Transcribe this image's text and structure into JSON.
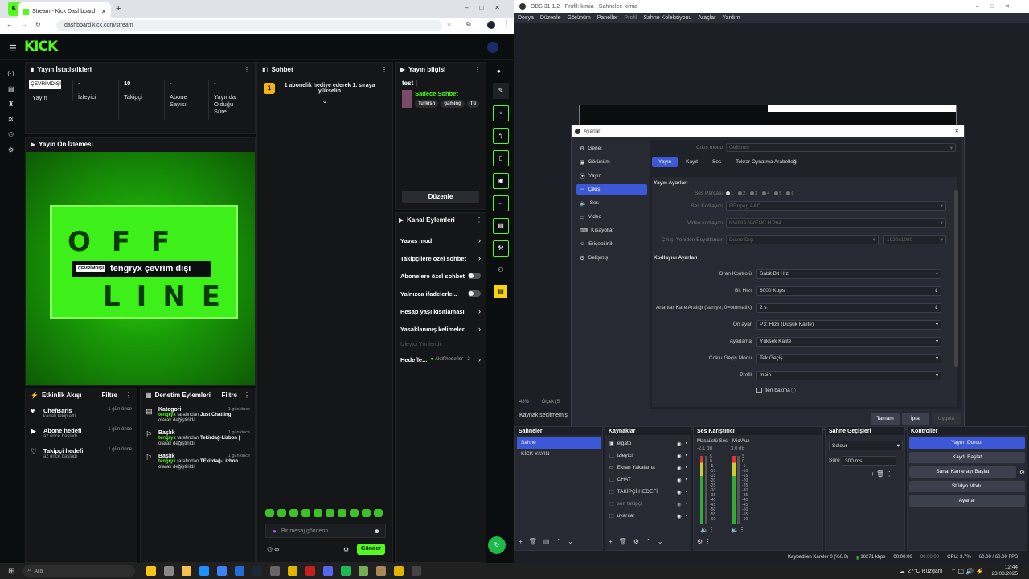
{
  "browser": {
    "tab_title": "Stream - Kick Dashboard",
    "url": "dashboard.kick.com/stream",
    "kick_badge": "K 0"
  },
  "kick": {
    "logo": "KICK",
    "stats": {
      "title": "Yayın İstatistikleri",
      "status_value": "ÇEVRİMDIŞI",
      "status_label": "Yayın",
      "viewers_value": "-",
      "viewers_label": "İzleyici",
      "followers_value": "10",
      "followers_label": "Takipçi",
      "subs_value": "-",
      "subs_label": "Abone Sayısı",
      "duration_value": "-",
      "duration_label": "Yayında Olduğu Süre"
    },
    "preview": {
      "title": "Yayın Ön İzlemesi",
      "badge": "ÇEVRİMDIŞI",
      "text": "tengryx çevrim dışı",
      "offline_row1": "OFF",
      "offline_row2": "LINE"
    },
    "chat": {
      "title": "Sohbet",
      "goal_badge": "1",
      "goal_text": "1 abonelik hediye ederek 1. sıraya yükselin",
      "input_placeholder": "Bir mesaj gönderin",
      "send_label": "Gönder"
    },
    "stream_info": {
      "title": "Yayın bilgisi",
      "stream_title": "test |",
      "category": "Sadece Sohbet",
      "tags": [
        "Turkish",
        "gaming",
        "Tü"
      ],
      "edit_label": "Düzenle"
    },
    "channel_actions": {
      "title": "Kanal Eylemleri",
      "items": [
        {
          "label": "Yavaş mod",
          "ctl": "chev"
        },
        {
          "label": "Takipçilere özel sohbet",
          "ctl": "chev"
        },
        {
          "label": "Abonelere özel sohbet",
          "ctl": "toggle"
        },
        {
          "label": "Yalnızca ifadelerle...",
          "ctl": "toggle"
        },
        {
          "label": "Hesap yaşı kısıtlaması",
          "ctl": "chev"
        },
        {
          "label": "Yasaklanmış kelimeler",
          "ctl": "chev"
        }
      ],
      "moderators": "İzleyici Yönlendir",
      "goals_label": "Hedefle...",
      "goals_value": "Aktif hedefler - 2"
    },
    "activity": {
      "title": "Etkinlik Akışı",
      "filter": "Filtre",
      "items": [
        {
          "name": "ChefBaris",
          "desc": "kanalı takip etti",
          "time": "1 gün önce"
        },
        {
          "name": "Abone hedefi",
          "desc": "az önce başladı",
          "time": "1 gün önce"
        },
        {
          "name": "Takipçi hedefi",
          "desc": "az önce başladı",
          "time": "1 gün önce"
        }
      ]
    },
    "mod": {
      "title": "Denetim Eylemleri",
      "filter": "Filtre",
      "items": [
        {
          "title": "Kategori",
          "time": "1 gün önce",
          "user": "tengryx",
          "mid": " tarafından ",
          "value": "Just Chatting",
          "tail": "olarak değiştirildi"
        },
        {
          "title": "Başlık",
          "time": "1 gün önce",
          "user": "tengryx",
          "mid": " tarafından ",
          "value": "Tekirdağ-Lizbon |",
          "tail": "olarak değiştirildi"
        },
        {
          "title": "Başlık",
          "time": "1 gün önce",
          "user": "tengryx",
          "mid": " tarafından ",
          "value": "TEkirdağ-Lizbon |",
          "tail": "olarak değiştirildi"
        }
      ]
    }
  },
  "obs": {
    "title": "OBS 31.1.2 - Profil: kimia - Sahneler: kimia",
    "menu": [
      "Dosya",
      "Düzenle",
      "Görünüm",
      "Paneller",
      "Profil",
      "Sahne Koleksiyonu",
      "Araçlar",
      "Yardım"
    ],
    "settings": {
      "title": "Ayarlar",
      "nav": [
        "Genel",
        "Görünüm",
        "Yayın",
        "Çıkış",
        "Ses",
        "Video",
        "Kısayollar",
        "Erişebilirlik",
        "Gelişmiş"
      ],
      "output_mode_label": "Çıkış modu",
      "output_mode": "Gelişmiş",
      "tabs": [
        "Yayın",
        "Kayıt",
        "Ses",
        "Tekrar Oynatma Arabelleği"
      ],
      "section1": "Yayın Ayarları",
      "audio_track_label": "Ses Parçası",
      "tracks": [
        "1",
        "2",
        "3",
        "4",
        "5",
        "6"
      ],
      "audio_encoder_label": "Ses Kodlayıcı",
      "audio_encoder": "FFmpeg AAC",
      "video_encoder_label": "Video kodlayıcı",
      "video_encoder": "NVIDIA NVENC H.264",
      "rescale_label": "Çıkışı Yeniden Boyutlandır",
      "rescale": "Devre Dışı",
      "rescale_res": "1920x1080",
      "section2": "Kodlayıcı Ayarları",
      "rows": [
        {
          "label": "Oran Kontrolü",
          "value": "Sabit Bit Hızı",
          "type": "select"
        },
        {
          "label": "Bit Hızı",
          "value": "8000 Kbps",
          "type": "spin"
        },
        {
          "label": "Anahtar Kare Aralığı (saniye, 0=otomatik)",
          "value": "2 s",
          "type": "spin"
        },
        {
          "label": "Ön ayar",
          "value": "P3: Hızlı (Düşük Kalite)",
          "type": "select"
        },
        {
          "label": "Ayarlama",
          "value": "Yüksek Kalite",
          "type": "select"
        },
        {
          "label": "Çoklu Geçiş Modu",
          "value": "Tek Geçiş",
          "type": "select"
        },
        {
          "label": "Profil",
          "value": "main",
          "type": "select"
        }
      ],
      "lookahead": "İleri bakma",
      "ok": "Tamam",
      "cancel": "İptal",
      "apply": "Uygula"
    },
    "no_source": "Kaynak seçilmemiş",
    "zoom": "48%",
    "zoom_label": "Ölçek (5",
    "docks": {
      "scenes": {
        "title": "Sahneler",
        "items": [
          "Sahne",
          "KİCK YAYIN"
        ]
      },
      "sources": {
        "title": "Kaynaklar",
        "items": [
          "elgato",
          "izleyici",
          "Ekran Yakalama",
          "CHAT",
          "TAKİPÇİ HEDEFİ",
          "son takipçi",
          "uyarılar"
        ]
      },
      "mixer": {
        "title": "Ses Karıştırıcı",
        "ch1": "Masaüstü Ses",
        "ch1_db": "-2.1 dB",
        "ch2": "Mic/Aux",
        "ch2_db": "3.0 dB",
        "scale": [
          "5",
          "0",
          "-5",
          "-10",
          "-15",
          "-20",
          "-25",
          "-30",
          "-35",
          "-40",
          "-45",
          "-50",
          "-55",
          "-60"
        ]
      },
      "transitions": {
        "title": "Sahne Geçişleri",
        "type": "Soldur",
        "duration_label": "Süre",
        "duration": "300 ms"
      },
      "controls": {
        "title": "Kontroller",
        "buttons": [
          "Yayını Durdur",
          "Kaydı Başlat",
          "Sanal Kamerayı Başlat",
          "Stüdyo Modu",
          "Ayarlar"
        ]
      }
    },
    "status": {
      "dropped": "Kaybedilen Kareler 0 (%0.0)",
      "bitrate": "10271 kbps",
      "stream_time": "00:00:06",
      "rec_time": "00:00:00",
      "cpu": "CPU: 3.7%",
      "fps": "60.00 / 60.00 FPS"
    }
  },
  "taskbar": {
    "search": "Ara",
    "weather": "27°C Rüzgarlı",
    "time": "12:44",
    "date": "23.08.2025"
  }
}
